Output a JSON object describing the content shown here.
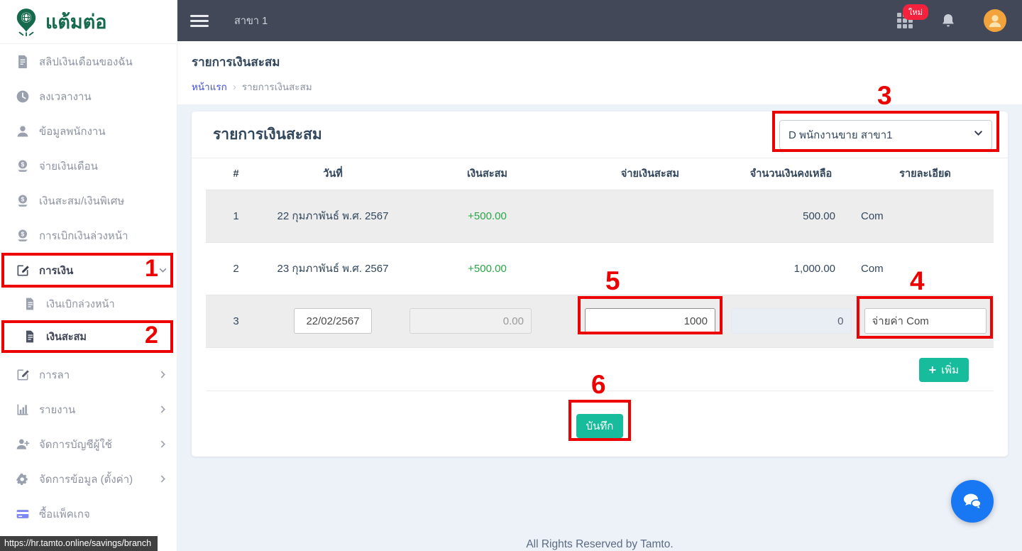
{
  "sidebar": {
    "logo_text": "แต้มต่อ",
    "items": [
      {
        "label": "สลิปเงินเดือนของฉัน",
        "icon": "document-icon"
      },
      {
        "label": "ลงเวลางาน",
        "icon": "clock-icon"
      },
      {
        "label": "ข้อมูลพนักงาน",
        "icon": "person-icon"
      },
      {
        "label": "จ่ายเงินเดือน",
        "icon": "money-icon"
      },
      {
        "label": "เงินสะสม/เงินพิเศษ",
        "icon": "money-icon"
      },
      {
        "label": "การเบิกเงินล่วงหน้า",
        "icon": "money-icon"
      },
      {
        "label": "การเงิน",
        "icon": "edit-icon",
        "state": "expanded-active"
      },
      {
        "label": "เงินเบิกล่วงหน้า",
        "icon": "file-icon",
        "submenu": true
      },
      {
        "label": "เงินสะสม",
        "icon": "file-icon",
        "submenu": true,
        "state": "active"
      },
      {
        "label": "การลา",
        "icon": "edit-icon",
        "expandable": true
      },
      {
        "label": "รายงาน",
        "icon": "bar-chart-icon",
        "expandable": true
      },
      {
        "label": "จัดการบัญชีผู้ใช้",
        "icon": "user-plus-icon",
        "expandable": true
      },
      {
        "label": "จัดการข้อมูล (ตั้งค่า)",
        "icon": "gears-icon",
        "expandable": true
      },
      {
        "label": "ซื้อแพ็คเกจ",
        "icon": "credit-card-icon"
      }
    ]
  },
  "topbar": {
    "branch": "สาขา 1",
    "badge": "ใหม่"
  },
  "page": {
    "title": "รายการเงินสะสม",
    "breadcrumb_home": "หน้าแรก",
    "breadcrumb_separator": "›",
    "breadcrumb_current": "รายการเงินสะสม"
  },
  "card": {
    "title": "รายการเงินสะสม",
    "employee_select": "D พนักงานขาย สาขา1",
    "table": {
      "headers": [
        "#",
        "วันที่",
        "เงินสะสม",
        "จ่ายเงินสะสม",
        "จำนวนเงินคงเหลือ",
        "รายละเอียด"
      ],
      "rows": [
        {
          "no": "1",
          "date": "22 กุมภาพันธ์ พ.ศ. 2567",
          "deposit": "+500.00",
          "withdraw": "",
          "balance": "500.00",
          "detail": "Com"
        },
        {
          "no": "2",
          "date": "23 กุมภาพันธ์ พ.ศ. 2567",
          "deposit": "+500.00",
          "withdraw": "",
          "balance": "1,000.00",
          "detail": "Com"
        }
      ],
      "new_row": {
        "no": "3",
        "date_value": "22/02/2567",
        "deposit_value": "0.00",
        "withdraw_value": "1000",
        "balance_value": "0",
        "detail_value": "จ่ายค่า Com"
      }
    },
    "add_button_plus": "+",
    "add_button": "เพิ่ม",
    "save_button": "บันทึก"
  },
  "annotations": {
    "n1": "1",
    "n2": "2",
    "n3": "3",
    "n4": "4",
    "n5": "5",
    "n6": "6"
  },
  "footer": "All Rights Reserved by Tamto.",
  "statusbar_url": "https://hr.tamto.online/savings/branch",
  "colors": {
    "accent_teal": "#16bc9c",
    "annotation_red": "#ec0000",
    "topbar_dark": "#424857",
    "link_blue": "#3f4bea",
    "positive_green": "#28a745",
    "badge_red": "#f5223d",
    "avatar_orange": "#f2a33c",
    "chat_blue": "#1877f2",
    "logo_green": "#15694d"
  }
}
